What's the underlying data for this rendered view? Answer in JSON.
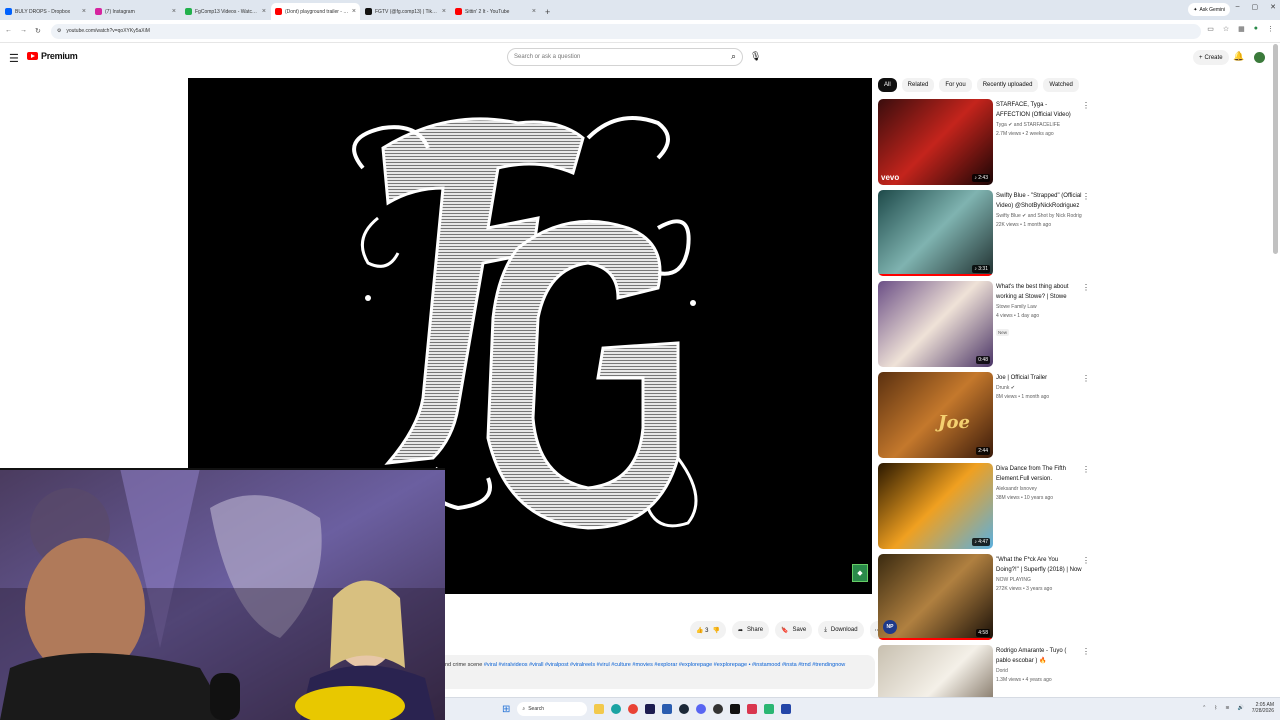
{
  "browser": {
    "tabs": [
      {
        "title": "BULY DROPS - Dropbox",
        "color": "#0061fe"
      },
      {
        "title": "(7) Instagram",
        "color": "#d6249f"
      },
      {
        "title": "FgComp13 Videos - Watch On",
        "color": "#22b14c"
      },
      {
        "title": "(Dont) playground trailer - YouTube",
        "color": "#ff0000",
        "active": true
      },
      {
        "title": "FGTV (@fg.comp13) | TikTok",
        "color": "#111111"
      },
      {
        "title": "Sittin' 2 It - YouTube",
        "color": "#ff0000"
      }
    ],
    "ask_gemini": "Ask Gemini",
    "url": "youtube.com/watch?v=qoXYKy5aXiM"
  },
  "youtube": {
    "logo_text": "Premium",
    "search_placeholder": "Search or ask a question",
    "create_label": "Create",
    "chips": [
      "All",
      "Related",
      "For you",
      "Recently uploaded",
      "Watched"
    ],
    "actions": {
      "likes": "3",
      "share": "Share",
      "save": "Save",
      "download": "Download"
    },
    "description": {
      "prefix": "nd crime scene ",
      "tags": "#viral #viralvideos #virall #viralpost #viralreels #virul #culture #movies #explorar #explorepage #explorepage • #instamood #insta #trnd #trendingnow"
    },
    "related": [
      {
        "title": "STARFACE, Tyga - AFFECTION (Official Video)",
        "channel": "Tyga ✔ and STARFACELIFE",
        "stats": "2.7M views • 2 weeks ago",
        "duration": "♪ 2:43",
        "watched": 0,
        "overlay": "vevo",
        "colors": [
          "#3a0d0d",
          "#c4241c",
          "#1a0505"
        ]
      },
      {
        "title": "Swifty Blue - \"Strapped\" (Official Video) @ShotByNickRodriguez",
        "channel": "Swifty Blue ✔ and Shot by Nick Rodriguez",
        "stats": "22K views • 1 month ago",
        "duration": "♪ 3:31",
        "watched": 1.0,
        "overlay": "",
        "colors": [
          "#1e4a4a",
          "#7fb3b0",
          "#203030"
        ]
      },
      {
        "title": "What's the best thing about working at Stowe? | Stowe Family...",
        "channel": "Stowe Family Law",
        "stats": "4 views • 1 day ago",
        "duration": "0:48",
        "watched": 0,
        "overlay": "",
        "badge": "New",
        "colors": [
          "#6b4f86",
          "#efe2d7",
          "#4a3466"
        ]
      },
      {
        "title": "Joe | Official Trailer",
        "channel": "Drunk ✔",
        "stats": "8M views • 1 month ago",
        "duration": "2:44",
        "watched": 0,
        "overlay": "Joe",
        "colors": [
          "#5a3010",
          "#c4782c",
          "#3a1a0a"
        ]
      },
      {
        "title": "Diva Dance from The Fifth Element.Full version.",
        "channel": "Aleksandr Isnovey",
        "stats": "38M views • 10 years ago",
        "duration": "♪ 4:47",
        "watched": 0,
        "overlay": "",
        "colors": [
          "#2a1800",
          "#f0a020",
          "#5ab0e0"
        ]
      },
      {
        "title": "\"What the F*ck Are You Doing?!\" | Superfly (2018) | Now Playing",
        "channel": "NOW PLAYING",
        "stats": "272K views • 3 years ago",
        "duration": "4:58",
        "watched": 1.0,
        "overlay": "NP",
        "colors": [
          "#3a2a10",
          "#b08040",
          "#1a1008"
        ]
      },
      {
        "title": "Rodrigo Amarante - Tuyo ( pablo escobar ) 🔥",
        "channel": "Dorid",
        "stats": "1.3M views • 4 years ago",
        "duration": "",
        "watched": 0,
        "overlay": "",
        "colors": [
          "#c8c0b0",
          "#f4f0e8",
          "#5a4a38"
        ]
      }
    ]
  },
  "taskbar": {
    "search": "Search",
    "time": "2:05 AM",
    "date": "7/28/2026"
  }
}
